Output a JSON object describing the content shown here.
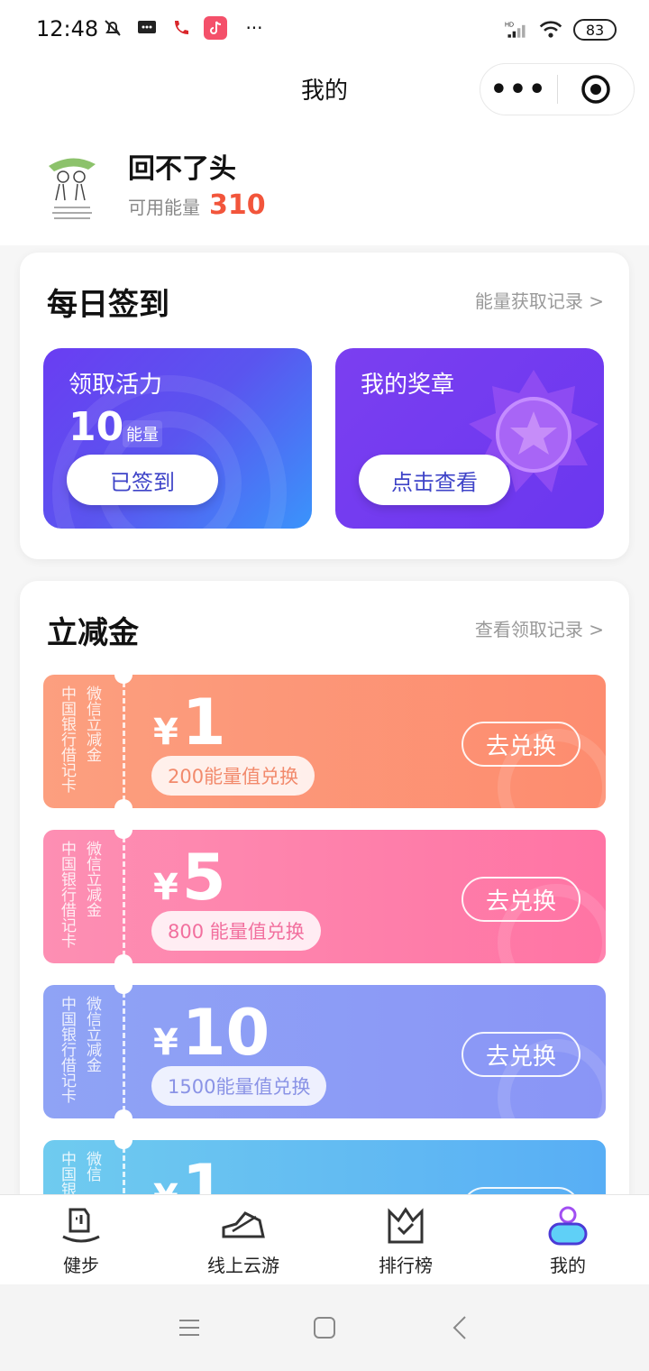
{
  "status_bar": {
    "time": "12:48",
    "battery": "83",
    "more": "···"
  },
  "nav": {
    "title": "我的",
    "more_label": "•••"
  },
  "profile": {
    "username": "回不了头",
    "energy_label": "可用能量",
    "energy_value": "310"
  },
  "daily_sign": {
    "title": "每日签到",
    "link": "能量获取记录 >",
    "left_card": {
      "label": "领取活力",
      "amount": "10",
      "unit": "能量",
      "button": "已签到"
    },
    "right_card": {
      "label": "我的奖章",
      "button": "点击查看"
    }
  },
  "coupons_section": {
    "title": "立减金",
    "link": "查看领取记录 >",
    "coupons": [
      {
        "side_a": "中国银行借记卡",
        "side_b": "微信立减金",
        "yen": "¥",
        "amount": "1",
        "cost": "200能量值兑换",
        "button": "去兑换",
        "color": "#fd8c6f",
        "pill_text_color": "#f28a6c"
      },
      {
        "side_a": "中国银行借记卡",
        "side_b": "微信立减金",
        "yen": "¥",
        "amount": "5",
        "cost": "800 能量值兑换",
        "button": "去兑换",
        "color": "#ff74a4",
        "pill_text_color": "#f26f9e"
      },
      {
        "side_a": "中国银行借记卡",
        "side_b": "微信立减金",
        "yen": "¥",
        "amount": "10",
        "cost": "1500能量值兑换",
        "button": "去兑换",
        "color": "#8a95f6",
        "pill_text_color": "#8a93e6"
      },
      {
        "side_a": "中国银",
        "side_b": "微信",
        "yen": "¥",
        "amount": "1",
        "cost": "",
        "button": "",
        "color": "#58aef5",
        "pill_text_color": "#58aef5"
      }
    ]
  },
  "tabbar": {
    "items": [
      {
        "label": "健步",
        "icon": "walk-icon"
      },
      {
        "label": "线上云游",
        "icon": "shoe-icon"
      },
      {
        "label": "排行榜",
        "icon": "crown-icon"
      },
      {
        "label": "我的",
        "icon": "user-icon",
        "active": true
      }
    ]
  }
}
